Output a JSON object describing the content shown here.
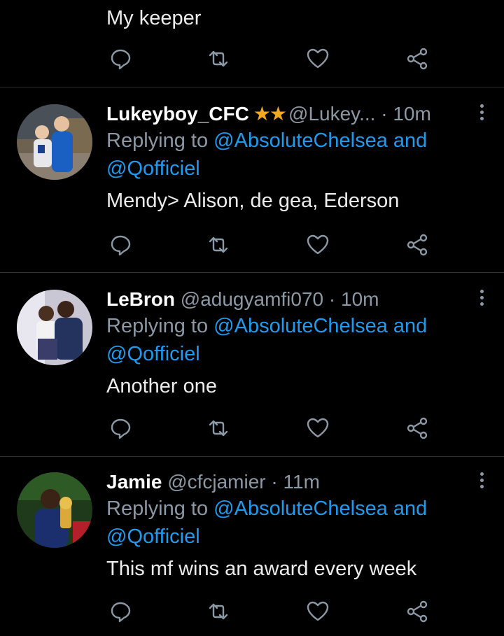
{
  "icons": [
    "reply-icon",
    "retweet-icon",
    "like-icon",
    "share-icon",
    "more-icon"
  ],
  "colors": {
    "background": "#000000",
    "link": "#1d9bf0",
    "muted": "#8b98a5",
    "star": "#f4a81d"
  },
  "partial_tweet": {
    "text": "My keeper"
  },
  "tweets": [
    {
      "name": "Lukeyboy_CFC",
      "badge": "★★",
      "handle": "@Lukey...",
      "separator": "·",
      "time": "10m",
      "replying_prefix": "Replying to",
      "replying_to_line1": "@AbsoluteChelsea and",
      "replying_to_line2": "@Qofficiel",
      "text": "Mendy> Alison, de gea, Ederson"
    },
    {
      "name": "LeBron",
      "handle": "@adugyamfi070",
      "separator": "·",
      "time": "10m",
      "replying_prefix": "Replying to",
      "replying_to_line1": "@AbsoluteChelsea and",
      "replying_to_line2": "@Qofficiel",
      "text": "Another one"
    },
    {
      "name": "Jamie",
      "handle": "@cfcjamier",
      "separator": "·",
      "time": "11m",
      "replying_prefix": "Replying to",
      "replying_to_line1": "@AbsoluteChelsea and",
      "replying_to_line2": "@Qofficiel",
      "text": "This mf wins an award every week"
    }
  ]
}
